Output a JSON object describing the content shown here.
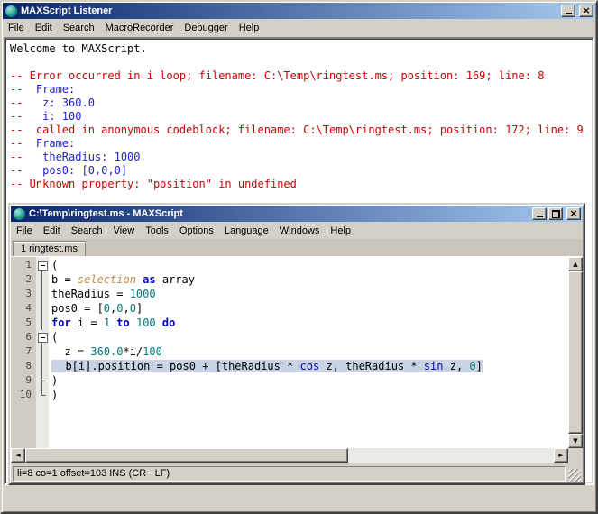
{
  "colors": {
    "titlebar_gradient_start": "#0a246a",
    "titlebar_gradient_end": "#a6caf0",
    "window_face": "#d4d0c8",
    "error_red": "#cc0000",
    "frame_blue": "#2020cc",
    "keyword_blue": "#0000c8",
    "number_teal": "#007878",
    "global_tan": "#c08a4a",
    "line_highlight": "#c9d3e3"
  },
  "icons": {
    "close": "×",
    "scroll_up": "▲",
    "scroll_down": "▼",
    "scroll_left": "◄",
    "scroll_right": "►"
  },
  "listener": {
    "title": "MAXScript Listener",
    "menus": [
      "File",
      "Edit",
      "Search",
      "MacroRecorder",
      "Debugger",
      "Help"
    ],
    "lines": [
      [
        {
          "t": "Welcome to MAXScript.",
          "c": "black"
        }
      ],
      [],
      [
        {
          "t": "-- Error occurred in i loop; filename: C:\\Temp\\ringtest.ms; position: 169; line: 8",
          "c": "red"
        }
      ],
      [
        {
          "t": "--  ",
          "c": "red"
        },
        {
          "t": "Frame:",
          "c": "blue"
        }
      ],
      [
        {
          "t": "--   ",
          "c": "red"
        },
        {
          "t": "z: 360.0",
          "c": "blue"
        }
      ],
      [
        {
          "t": "--   ",
          "c": "red"
        },
        {
          "t": "i: 100",
          "c": "blue"
        }
      ],
      [
        {
          "t": "--  called in anonymous codeblock; filename: C:\\Temp\\ringtest.ms; position: 172; line: 9",
          "c": "red"
        }
      ],
      [
        {
          "t": "--  ",
          "c": "red"
        },
        {
          "t": "Frame:",
          "c": "blue"
        }
      ],
      [
        {
          "t": "--   ",
          "c": "red"
        },
        {
          "t": "theRadius: 1000",
          "c": "blue"
        }
      ],
      [
        {
          "t": "--   ",
          "c": "red"
        },
        {
          "t": "pos0: [0,0,0]",
          "c": "blue"
        }
      ],
      [
        {
          "t": "-- Unknown property: \"position\" in undefined",
          "c": "red"
        }
      ]
    ]
  },
  "editor": {
    "title": "C:\\Temp\\ringtest.ms - MAXScript",
    "menus": [
      "File",
      "Edit",
      "Search",
      "View",
      "Tools",
      "Options",
      "Language",
      "Windows",
      "Help"
    ],
    "tab": "1 ringtest.ms",
    "status": "li=8 co=1 offset=103 INS (CR +LF)",
    "lines": [
      {
        "num": 1,
        "fold": "box",
        "tokens": [
          {
            "t": "(",
            "c": "plain"
          }
        ]
      },
      {
        "num": 2,
        "fold": "line",
        "tokens": [
          {
            "t": "b = ",
            "c": "plain"
          },
          {
            "t": "selection",
            "c": "global"
          },
          {
            "t": " ",
            "c": "plain"
          },
          {
            "t": "as",
            "c": "kw"
          },
          {
            "t": " array",
            "c": "plain"
          }
        ]
      },
      {
        "num": 3,
        "fold": "line",
        "tokens": [
          {
            "t": "theRadius = ",
            "c": "plain"
          },
          {
            "t": "1000",
            "c": "num"
          }
        ]
      },
      {
        "num": 4,
        "fold": "line",
        "tokens": [
          {
            "t": "pos0 = [",
            "c": "plain"
          },
          {
            "t": "0",
            "c": "num"
          },
          {
            "t": ",",
            "c": "plain"
          },
          {
            "t": "0",
            "c": "num"
          },
          {
            "t": ",",
            "c": "plain"
          },
          {
            "t": "0",
            "c": "num"
          },
          {
            "t": "]",
            "c": "plain"
          }
        ]
      },
      {
        "num": 5,
        "fold": "line",
        "tokens": [
          {
            "t": "for",
            "c": "kw"
          },
          {
            "t": " i = ",
            "c": "plain"
          },
          {
            "t": "1",
            "c": "num"
          },
          {
            "t": " ",
            "c": "plain"
          },
          {
            "t": "to",
            "c": "kw"
          },
          {
            "t": " ",
            "c": "plain"
          },
          {
            "t": "100",
            "c": "num"
          },
          {
            "t": " ",
            "c": "plain"
          },
          {
            "t": "do",
            "c": "kw"
          }
        ]
      },
      {
        "num": 6,
        "fold": "box",
        "tokens": [
          {
            "t": "(",
            "c": "plain"
          }
        ]
      },
      {
        "num": 7,
        "fold": "line",
        "tokens": [
          {
            "t": "  z = ",
            "c": "plain"
          },
          {
            "t": "360.0",
            "c": "num"
          },
          {
            "t": "*i/",
            "c": "plain"
          },
          {
            "t": "100",
            "c": "num"
          }
        ]
      },
      {
        "num": 8,
        "fold": "line",
        "highlight": true,
        "tokens": [
          {
            "t": "  b[i].position = pos0 + [theRadius * ",
            "c": "plain"
          },
          {
            "t": "cos",
            "c": "fn"
          },
          {
            "t": " z, theRadius * ",
            "c": "plain"
          },
          {
            "t": "sin",
            "c": "fn"
          },
          {
            "t": " z, ",
            "c": "plain"
          },
          {
            "t": "0",
            "c": "num"
          },
          {
            "t": "]",
            "c": "plain"
          }
        ]
      },
      {
        "num": 9,
        "fold": "tee",
        "tokens": [
          {
            "t": ")",
            "c": "plain"
          }
        ]
      },
      {
        "num": 10,
        "fold": "corner",
        "tokens": [
          {
            "t": ")",
            "c": "plain"
          }
        ]
      }
    ]
  }
}
